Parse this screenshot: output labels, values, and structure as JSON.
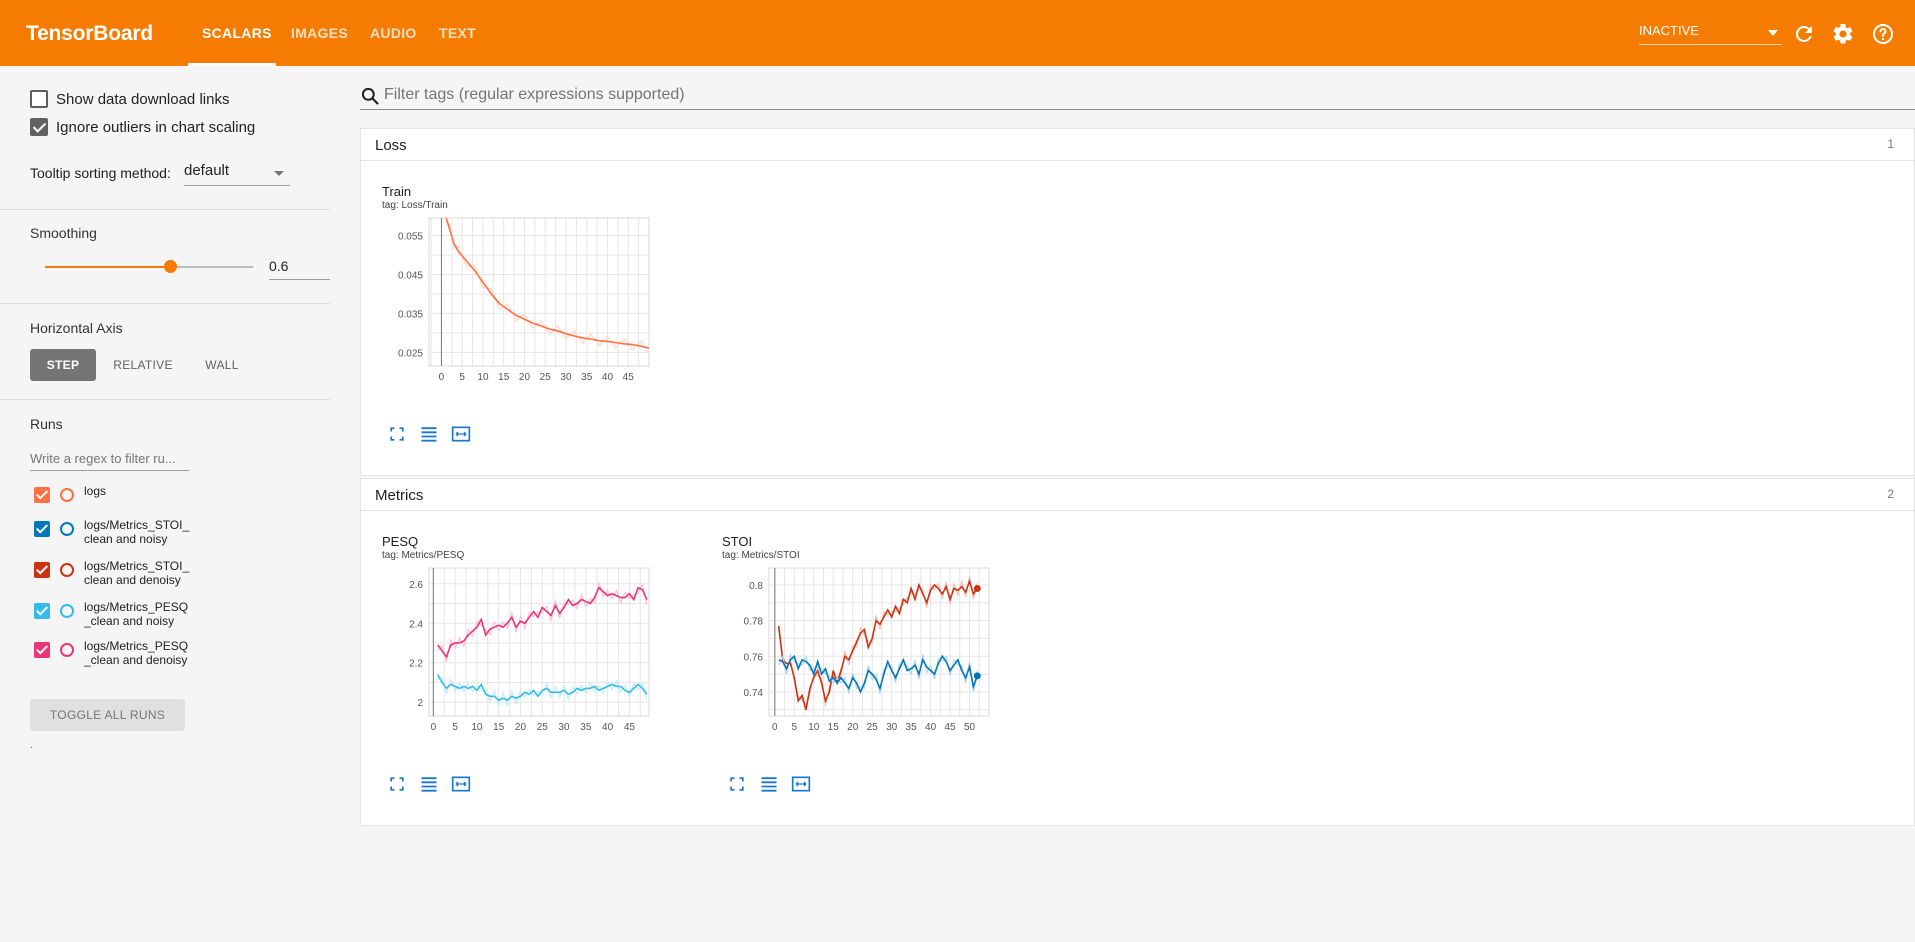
{
  "header": {
    "brand": "TensorBoard",
    "tabs": [
      {
        "label": "SCALARS",
        "active": true
      },
      {
        "label": "IMAGES",
        "active": false
      },
      {
        "label": "AUDIO",
        "active": false
      },
      {
        "label": "TEXT",
        "active": false
      }
    ],
    "status": "INACTIVE",
    "icons": [
      "refresh-icon",
      "gear-icon",
      "help-icon"
    ]
  },
  "sidebar": {
    "show_download_links": {
      "label": "Show data download links",
      "checked": false
    },
    "ignore_outliers": {
      "label": "Ignore outliers in chart scaling",
      "checked": true
    },
    "tooltip_sorting": {
      "label": "Tooltip sorting method:",
      "value": "default"
    },
    "smoothing": {
      "title": "Smoothing",
      "value": "0.6",
      "fraction": 0.6
    },
    "horizontal_axis": {
      "title": "Horizontal Axis",
      "options": [
        {
          "label": "STEP",
          "active": true
        },
        {
          "label": "RELATIVE",
          "active": false
        },
        {
          "label": "WALL",
          "active": false
        }
      ]
    },
    "runs": {
      "title": "Runs",
      "filter_placeholder": "Write a regex to filter ru...",
      "items": [
        {
          "label": "logs",
          "color": "#ff7043"
        },
        {
          "label": "logs/Metrics_STOI_clean and noisy",
          "color": "#0077bb"
        },
        {
          "label": "logs/Metrics_STOI_clean and denoisy",
          "color": "#cc3311"
        },
        {
          "label": "logs/Metrics_PESQ_clean and noisy",
          "color": "#33bbee"
        },
        {
          "label": "logs/Metrics_PESQ_clean and denoisy",
          "color": "#ee3377"
        }
      ],
      "toggle_label": "TOGGLE ALL RUNS",
      "footnote": "."
    }
  },
  "main": {
    "filter_placeholder": "Filter tags (regular expressions supported)",
    "sections": [
      {
        "title": "Loss",
        "count": "1"
      },
      {
        "title": "Metrics",
        "count": "2"
      }
    ]
  },
  "chart_data": [
    {
      "type": "line",
      "title": "Train",
      "tag": "tag: Loss/Train",
      "xticks": [
        0,
        5,
        10,
        15,
        20,
        25,
        30,
        35,
        40,
        45
      ],
      "yticks": [
        0.025,
        0.035,
        0.045,
        0.055
      ],
      "ytick_labels": [
        "0.025",
        "0.035",
        "0.045",
        "0.055"
      ],
      "xlim": [
        -3,
        50
      ],
      "ylim": [
        0.0215,
        0.0595
      ],
      "series": [
        {
          "color": "#ff7043",
          "x": [
            1,
            2,
            3,
            4,
            6,
            8,
            10,
            12,
            14,
            16,
            18,
            20,
            22,
            24,
            26,
            28,
            30,
            32,
            34,
            36,
            38,
            40,
            42,
            44,
            46,
            48,
            50
          ],
          "y": [
            0.06,
            0.0565,
            0.053,
            0.051,
            0.0485,
            0.046,
            0.043,
            0.04,
            0.0375,
            0.036,
            0.0345,
            0.0335,
            0.0325,
            0.0318,
            0.031,
            0.0305,
            0.0298,
            0.0292,
            0.0287,
            0.0284,
            0.028,
            0.0278,
            0.0275,
            0.0272,
            0.027,
            0.0266,
            0.0261
          ]
        }
      ],
      "grid": true
    },
    {
      "type": "line",
      "title": "PESQ",
      "tag": "tag: Metrics/PESQ",
      "xticks": [
        0,
        5,
        10,
        15,
        20,
        25,
        30,
        35,
        40,
        45
      ],
      "yticks": [
        2.0,
        2.2,
        2.4,
        2.6
      ],
      "ytick_labels": [
        "2",
        "2.2",
        "2.4",
        "2.6"
      ],
      "xlim": [
        -1,
        49.5
      ],
      "ylim": [
        1.93,
        2.68
      ],
      "series": [
        {
          "color": "#ee3377",
          "x": [
            1,
            2,
            3,
            4,
            5,
            6,
            7,
            8,
            9,
            10,
            11,
            12,
            13,
            14,
            15,
            16,
            17,
            18,
            19,
            20,
            21,
            22,
            23,
            24,
            25,
            26,
            27,
            28,
            29,
            30,
            31,
            32,
            33,
            34,
            35,
            36,
            37,
            38,
            39,
            40,
            41,
            42,
            43,
            44,
            45,
            46,
            47,
            48,
            49
          ],
          "y": [
            2.29,
            2.26,
            2.23,
            2.29,
            2.3,
            2.3,
            2.31,
            2.34,
            2.36,
            2.38,
            2.42,
            2.34,
            2.37,
            2.38,
            2.39,
            2.38,
            2.4,
            2.43,
            2.38,
            2.41,
            2.4,
            2.43,
            2.46,
            2.43,
            2.48,
            2.46,
            2.44,
            2.49,
            2.45,
            2.48,
            2.52,
            2.49,
            2.5,
            2.52,
            2.51,
            2.5,
            2.53,
            2.58,
            2.56,
            2.54,
            2.55,
            2.54,
            2.53,
            2.53,
            2.55,
            2.52,
            2.58,
            2.57,
            2.52
          ]
        },
        {
          "color": "#33bbee",
          "x": [
            1,
            2,
            3,
            4,
            5,
            6,
            7,
            8,
            9,
            10,
            11,
            12,
            13,
            14,
            15,
            16,
            17,
            18,
            19,
            20,
            21,
            22,
            23,
            24,
            25,
            26,
            27,
            28,
            29,
            30,
            31,
            32,
            33,
            34,
            35,
            36,
            37,
            38,
            39,
            40,
            41,
            42,
            43,
            44,
            45,
            46,
            47,
            48,
            49
          ],
          "y": [
            2.14,
            2.1,
            2.07,
            2.09,
            2.08,
            2.07,
            2.08,
            2.07,
            2.08,
            2.06,
            2.09,
            2.04,
            2.03,
            2.03,
            2.01,
            2.02,
            2.01,
            2.03,
            2.02,
            2.03,
            2.05,
            2.04,
            2.06,
            2.03,
            2.06,
            2.07,
            2.05,
            2.05,
            2.05,
            2.06,
            2.04,
            2.05,
            2.07,
            2.06,
            2.07,
            2.07,
            2.08,
            2.06,
            2.07,
            2.08,
            2.09,
            2.08,
            2.08,
            2.06,
            2.05,
            2.07,
            2.09,
            2.07,
            2.04
          ]
        }
      ],
      "grid": true
    },
    {
      "type": "line",
      "title": "STOI",
      "tag": "tag: Metrics/STOI",
      "xticks": [
        0,
        5,
        10,
        15,
        20,
        25,
        30,
        35,
        40,
        45,
        50
      ],
      "yticks": [
        0.74,
        0.76,
        0.78,
        0.8
      ],
      "ytick_labels": [
        "0.74",
        "0.76",
        "0.78",
        "0.8"
      ],
      "xlim": [
        -1.5,
        55
      ],
      "ylim": [
        0.7265,
        0.8095
      ],
      "series": [
        {
          "color": "#cc3311",
          "x": [
            1,
            2,
            3,
            4,
            5,
            6,
            7,
            8,
            9,
            10,
            11,
            12,
            13,
            14,
            15,
            16,
            17,
            18,
            19,
            20,
            21,
            22,
            23,
            24,
            25,
            26,
            27,
            28,
            29,
            30,
            31,
            32,
            33,
            34,
            35,
            36,
            37,
            38,
            39,
            40,
            41,
            42,
            43,
            44,
            45,
            46,
            47,
            48,
            49,
            50,
            51,
            52
          ],
          "y": [
            0.777,
            0.758,
            0.756,
            0.756,
            0.748,
            0.735,
            0.738,
            0.73,
            0.742,
            0.748,
            0.752,
            0.745,
            0.735,
            0.74,
            0.752,
            0.745,
            0.752,
            0.76,
            0.758,
            0.763,
            0.768,
            0.773,
            0.775,
            0.765,
            0.77,
            0.78,
            0.778,
            0.782,
            0.786,
            0.782,
            0.788,
            0.784,
            0.792,
            0.79,
            0.798,
            0.792,
            0.8,
            0.795,
            0.79,
            0.797,
            0.8,
            0.798,
            0.795,
            0.799,
            0.792,
            0.798,
            0.797,
            0.799,
            0.796,
            0.802,
            0.795,
            0.798
          ]
        },
        {
          "color": "#0077bb",
          "x": [
            1,
            2,
            3,
            4,
            5,
            6,
            7,
            8,
            9,
            10,
            11,
            12,
            13,
            14,
            15,
            16,
            17,
            18,
            19,
            20,
            21,
            22,
            23,
            24,
            25,
            26,
            27,
            28,
            29,
            30,
            31,
            32,
            33,
            34,
            35,
            36,
            37,
            38,
            39,
            40,
            41,
            42,
            43,
            44,
            45,
            46,
            47,
            48,
            49,
            50,
            51,
            52
          ],
          "y": [
            0.758,
            0.757,
            0.753,
            0.758,
            0.76,
            0.753,
            0.758,
            0.757,
            0.755,
            0.75,
            0.757,
            0.75,
            0.753,
            0.746,
            0.748,
            0.745,
            0.748,
            0.745,
            0.742,
            0.748,
            0.745,
            0.74,
            0.745,
            0.752,
            0.75,
            0.747,
            0.742,
            0.75,
            0.757,
            0.752,
            0.748,
            0.753,
            0.758,
            0.752,
            0.753,
            0.755,
            0.75,
            0.758,
            0.754,
            0.752,
            0.75,
            0.756,
            0.76,
            0.757,
            0.752,
            0.755,
            0.758,
            0.752,
            0.748,
            0.754,
            0.743,
            0.749
          ]
        }
      ],
      "grid": true
    }
  ]
}
